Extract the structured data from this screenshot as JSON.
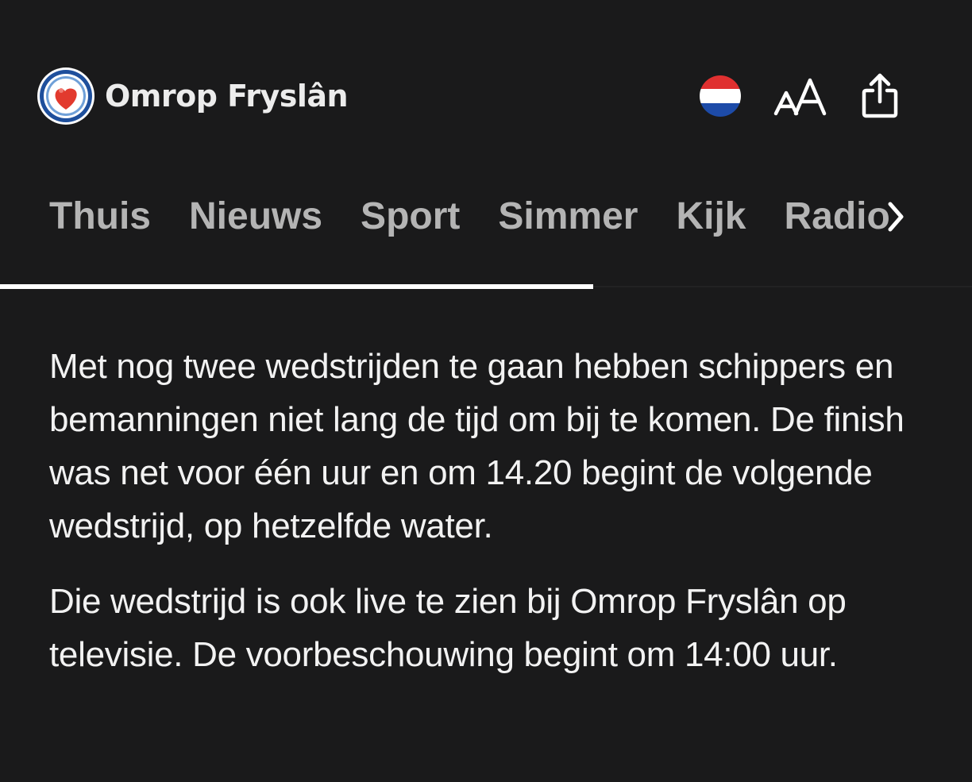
{
  "app": {
    "brand_name": "Omrop Fryslân",
    "logo_icon": "omrop-fryslan-heart-logo",
    "colors": {
      "background": "#1a1a1b",
      "logo_blue": "#1e4f9c",
      "logo_red": "#e23a2e",
      "flag_red": "#e03030",
      "flag_blue": "#1d4ba8",
      "nav_text": "#b4b4b4",
      "text": "#f2f2f2"
    }
  },
  "toolbar": {
    "language_icon": "netherlands-flag-icon",
    "font_size_icon": "text-size-icon",
    "share_icon": "share-icon"
  },
  "nav": {
    "items": [
      {
        "label": "Thuis"
      },
      {
        "label": "Nieuws"
      },
      {
        "label": "Sport"
      },
      {
        "label": "Simmer"
      },
      {
        "label": "Kijk"
      },
      {
        "label": "Radio"
      }
    ],
    "more_icon": "chevron-right-icon",
    "reading_progress": 0.61
  },
  "article": {
    "paragraphs": [
      "Met nog twee wedstrijden te gaan hebben schippers en bemanningen niet lang de tijd om bij te komen. De finish was net voor één uur en om 14.20 begint de volgende wedstrijd, op hetzelfde water.",
      "Die wedstrijd is ook live te zien bij Omrop Fryslân op televisie. De voorbeschouwing begint om 14:00 uur."
    ]
  }
}
